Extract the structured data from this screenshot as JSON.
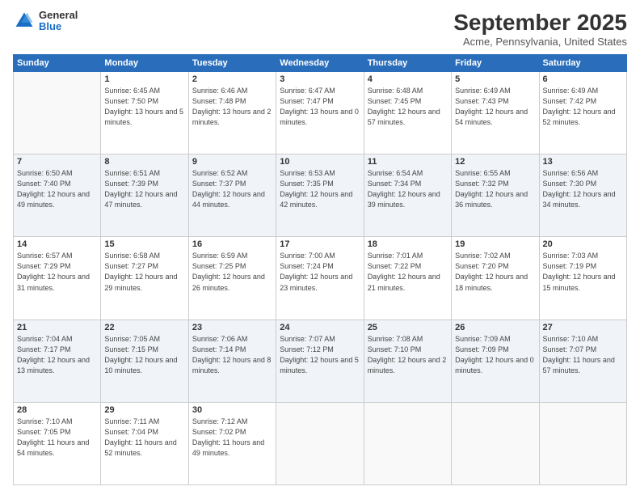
{
  "logo": {
    "general": "General",
    "blue": "Blue"
  },
  "title": "September 2025",
  "location": "Acme, Pennsylvania, United States",
  "days_of_week": [
    "Sunday",
    "Monday",
    "Tuesday",
    "Wednesday",
    "Thursday",
    "Friday",
    "Saturday"
  ],
  "weeks": [
    [
      {
        "day": "",
        "sunrise": "",
        "sunset": "",
        "daylight": ""
      },
      {
        "day": "1",
        "sunrise": "Sunrise: 6:45 AM",
        "sunset": "Sunset: 7:50 PM",
        "daylight": "Daylight: 13 hours and 5 minutes."
      },
      {
        "day": "2",
        "sunrise": "Sunrise: 6:46 AM",
        "sunset": "Sunset: 7:48 PM",
        "daylight": "Daylight: 13 hours and 2 minutes."
      },
      {
        "day": "3",
        "sunrise": "Sunrise: 6:47 AM",
        "sunset": "Sunset: 7:47 PM",
        "daylight": "Daylight: 13 hours and 0 minutes."
      },
      {
        "day": "4",
        "sunrise": "Sunrise: 6:48 AM",
        "sunset": "Sunset: 7:45 PM",
        "daylight": "Daylight: 12 hours and 57 minutes."
      },
      {
        "day": "5",
        "sunrise": "Sunrise: 6:49 AM",
        "sunset": "Sunset: 7:43 PM",
        "daylight": "Daylight: 12 hours and 54 minutes."
      },
      {
        "day": "6",
        "sunrise": "Sunrise: 6:49 AM",
        "sunset": "Sunset: 7:42 PM",
        "daylight": "Daylight: 12 hours and 52 minutes."
      }
    ],
    [
      {
        "day": "7",
        "sunrise": "Sunrise: 6:50 AM",
        "sunset": "Sunset: 7:40 PM",
        "daylight": "Daylight: 12 hours and 49 minutes."
      },
      {
        "day": "8",
        "sunrise": "Sunrise: 6:51 AM",
        "sunset": "Sunset: 7:39 PM",
        "daylight": "Daylight: 12 hours and 47 minutes."
      },
      {
        "day": "9",
        "sunrise": "Sunrise: 6:52 AM",
        "sunset": "Sunset: 7:37 PM",
        "daylight": "Daylight: 12 hours and 44 minutes."
      },
      {
        "day": "10",
        "sunrise": "Sunrise: 6:53 AM",
        "sunset": "Sunset: 7:35 PM",
        "daylight": "Daylight: 12 hours and 42 minutes."
      },
      {
        "day": "11",
        "sunrise": "Sunrise: 6:54 AM",
        "sunset": "Sunset: 7:34 PM",
        "daylight": "Daylight: 12 hours and 39 minutes."
      },
      {
        "day": "12",
        "sunrise": "Sunrise: 6:55 AM",
        "sunset": "Sunset: 7:32 PM",
        "daylight": "Daylight: 12 hours and 36 minutes."
      },
      {
        "day": "13",
        "sunrise": "Sunrise: 6:56 AM",
        "sunset": "Sunset: 7:30 PM",
        "daylight": "Daylight: 12 hours and 34 minutes."
      }
    ],
    [
      {
        "day": "14",
        "sunrise": "Sunrise: 6:57 AM",
        "sunset": "Sunset: 7:29 PM",
        "daylight": "Daylight: 12 hours and 31 minutes."
      },
      {
        "day": "15",
        "sunrise": "Sunrise: 6:58 AM",
        "sunset": "Sunset: 7:27 PM",
        "daylight": "Daylight: 12 hours and 29 minutes."
      },
      {
        "day": "16",
        "sunrise": "Sunrise: 6:59 AM",
        "sunset": "Sunset: 7:25 PM",
        "daylight": "Daylight: 12 hours and 26 minutes."
      },
      {
        "day": "17",
        "sunrise": "Sunrise: 7:00 AM",
        "sunset": "Sunset: 7:24 PM",
        "daylight": "Daylight: 12 hours and 23 minutes."
      },
      {
        "day": "18",
        "sunrise": "Sunrise: 7:01 AM",
        "sunset": "Sunset: 7:22 PM",
        "daylight": "Daylight: 12 hours and 21 minutes."
      },
      {
        "day": "19",
        "sunrise": "Sunrise: 7:02 AM",
        "sunset": "Sunset: 7:20 PM",
        "daylight": "Daylight: 12 hours and 18 minutes."
      },
      {
        "day": "20",
        "sunrise": "Sunrise: 7:03 AM",
        "sunset": "Sunset: 7:19 PM",
        "daylight": "Daylight: 12 hours and 15 minutes."
      }
    ],
    [
      {
        "day": "21",
        "sunrise": "Sunrise: 7:04 AM",
        "sunset": "Sunset: 7:17 PM",
        "daylight": "Daylight: 12 hours and 13 minutes."
      },
      {
        "day": "22",
        "sunrise": "Sunrise: 7:05 AM",
        "sunset": "Sunset: 7:15 PM",
        "daylight": "Daylight: 12 hours and 10 minutes."
      },
      {
        "day": "23",
        "sunrise": "Sunrise: 7:06 AM",
        "sunset": "Sunset: 7:14 PM",
        "daylight": "Daylight: 12 hours and 8 minutes."
      },
      {
        "day": "24",
        "sunrise": "Sunrise: 7:07 AM",
        "sunset": "Sunset: 7:12 PM",
        "daylight": "Daylight: 12 hours and 5 minutes."
      },
      {
        "day": "25",
        "sunrise": "Sunrise: 7:08 AM",
        "sunset": "Sunset: 7:10 PM",
        "daylight": "Daylight: 12 hours and 2 minutes."
      },
      {
        "day": "26",
        "sunrise": "Sunrise: 7:09 AM",
        "sunset": "Sunset: 7:09 PM",
        "daylight": "Daylight: 12 hours and 0 minutes."
      },
      {
        "day": "27",
        "sunrise": "Sunrise: 7:10 AM",
        "sunset": "Sunset: 7:07 PM",
        "daylight": "Daylight: 11 hours and 57 minutes."
      }
    ],
    [
      {
        "day": "28",
        "sunrise": "Sunrise: 7:10 AM",
        "sunset": "Sunset: 7:05 PM",
        "daylight": "Daylight: 11 hours and 54 minutes."
      },
      {
        "day": "29",
        "sunrise": "Sunrise: 7:11 AM",
        "sunset": "Sunset: 7:04 PM",
        "daylight": "Daylight: 11 hours and 52 minutes."
      },
      {
        "day": "30",
        "sunrise": "Sunrise: 7:12 AM",
        "sunset": "Sunset: 7:02 PM",
        "daylight": "Daylight: 11 hours and 49 minutes."
      },
      {
        "day": "",
        "sunrise": "",
        "sunset": "",
        "daylight": ""
      },
      {
        "day": "",
        "sunrise": "",
        "sunset": "",
        "daylight": ""
      },
      {
        "day": "",
        "sunrise": "",
        "sunset": "",
        "daylight": ""
      },
      {
        "day": "",
        "sunrise": "",
        "sunset": "",
        "daylight": ""
      }
    ]
  ]
}
